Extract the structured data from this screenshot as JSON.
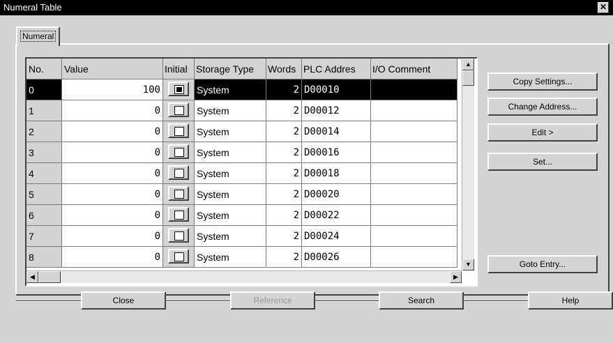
{
  "window": {
    "title": "Numeral Table",
    "close_glyph": "✕"
  },
  "tab": {
    "label": "Numeral"
  },
  "table": {
    "columns": [
      "No.",
      "Value",
      "Initial",
      "Storage Type",
      "Words",
      "PLC Addres",
      "I/O Comment"
    ],
    "rows": [
      {
        "no": "0",
        "value": "100",
        "initial": true,
        "storage": "System",
        "words": "2",
        "plc": "D00010",
        "comment": ""
      },
      {
        "no": "1",
        "value": "0",
        "initial": false,
        "storage": "System",
        "words": "2",
        "plc": "D00012",
        "comment": ""
      },
      {
        "no": "2",
        "value": "0",
        "initial": false,
        "storage": "System",
        "words": "2",
        "plc": "D00014",
        "comment": ""
      },
      {
        "no": "3",
        "value": "0",
        "initial": false,
        "storage": "System",
        "words": "2",
        "plc": "D00016",
        "comment": ""
      },
      {
        "no": "4",
        "value": "0",
        "initial": false,
        "storage": "System",
        "words": "2",
        "plc": "D00018",
        "comment": ""
      },
      {
        "no": "5",
        "value": "0",
        "initial": false,
        "storage": "System",
        "words": "2",
        "plc": "D00020",
        "comment": ""
      },
      {
        "no": "6",
        "value": "0",
        "initial": false,
        "storage": "System",
        "words": "2",
        "plc": "D00022",
        "comment": ""
      },
      {
        "no": "7",
        "value": "0",
        "initial": false,
        "storage": "System",
        "words": "2",
        "plc": "D00024",
        "comment": ""
      },
      {
        "no": "8",
        "value": "0",
        "initial": false,
        "storage": "System",
        "words": "2",
        "plc": "D00026",
        "comment": ""
      }
    ],
    "selected_row": 0
  },
  "side_buttons": {
    "copy_settings": "Copy Settings...",
    "change_address": "Change Address...",
    "edit": "Edit >",
    "set": "Set...",
    "goto_entry": "Goto Entry..."
  },
  "bottom_buttons": {
    "close": "Close",
    "reference": "Reference",
    "search": "Search",
    "help": "Help"
  },
  "scroll_glyphs": {
    "up": "▲",
    "down": "▼",
    "left": "◀",
    "right": "▶"
  }
}
